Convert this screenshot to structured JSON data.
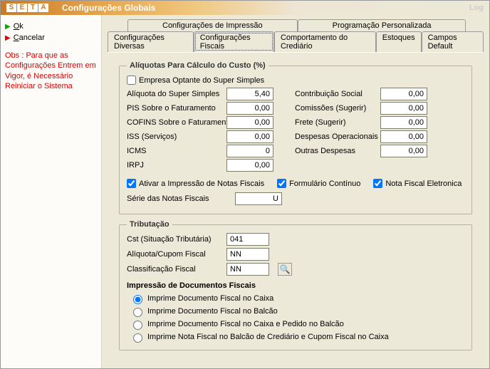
{
  "window": {
    "title": "Configurações Globais",
    "log": "Log"
  },
  "logo": [
    "S",
    "E",
    "T",
    "A"
  ],
  "sidebar": {
    "ok": "Ok",
    "cancel": "Cancelar",
    "obs": "Obs : Para que as Configurações Entrem em Vigor, é Necessário Reiniciar o Sistema"
  },
  "tabs_top": {
    "t1": "Configurações de Impressão",
    "t2": "Programação Personalizada"
  },
  "tabs_bottom": {
    "b1": "Configurações Diversas",
    "b2": "Configurações Fiscais",
    "b3": "Comportamento do Crediário",
    "b4": "Estoques",
    "b5": "Campos Default"
  },
  "aliquotas": {
    "legend": "Alíquotas Para Cálculo do Custo (%)",
    "optante": "Empresa Optante do Super Simples",
    "labels": {
      "supersimples": "Alíquota do Super Simples",
      "pis": "PIS Sobre o Faturamento",
      "cofins": "COFINS Sobre o Faturamento",
      "iss": "ISS (Serviços)",
      "icms": "ICMS",
      "irpj": "IRPJ",
      "contrib": "Contribuição Social",
      "comissoes": "Comissões (Sugerir)",
      "frete": "Frete (Sugerir)",
      "despop": "Despesas Operacionais",
      "outras": "Outras Despesas"
    },
    "values": {
      "supersimples": "5,40",
      "pis": "0,00",
      "cofins": "0,00",
      "iss": "0,00",
      "icms": "0",
      "irpj": "0,00",
      "contrib": "0,00",
      "comissoes": "0,00",
      "frete": "0,00",
      "despop": "0,00",
      "outras": "0,00"
    },
    "chk_ativar": "Ativar a Impressão de Notas Fiscais",
    "chk_form": "Formulário Contínuo",
    "chk_nfe": "Nota Fiscal Eletronica",
    "serie_lbl": "Série das Notas Fiscais",
    "serie_val": "U"
  },
  "tributacao": {
    "legend": "Tributação",
    "cst_lbl": "Cst (Situação Tributária)",
    "cst_val": "041",
    "aliq_lbl": "Alíquota/Cupom Fiscal",
    "aliq_val": "NN",
    "class_lbl": "Classificação Fiscal",
    "class_val": "NN"
  },
  "impressao": {
    "head": "Impressão de Documentos Fiscais",
    "r1": "Imprime Documento Fiscal no Caixa",
    "r2": "Imprime Documento Fiscal no Balcão",
    "r3": "Imprime Documento Fiscal no Caixa e Pedido no Balcão",
    "r4": "Imprime Nota Fiscal no Balcão de Crediário e Cupom Fiscal no Caixa"
  }
}
